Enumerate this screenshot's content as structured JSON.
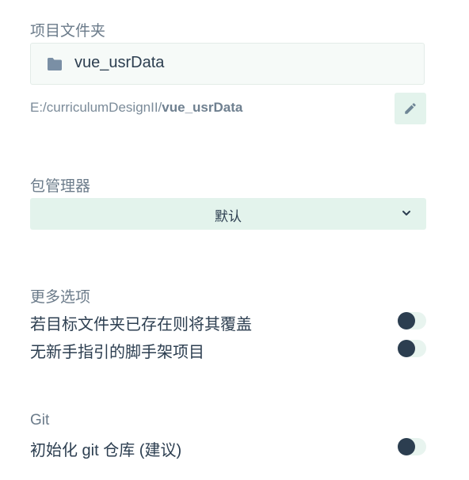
{
  "project_folder": {
    "section_label": "项目文件夹",
    "folder_name": "vue_usrData",
    "path_prefix": "E:/curriculumDesignII/",
    "path_bold": "vue_usrData",
    "icon": "folder-icon",
    "edit_icon": "pencil-icon"
  },
  "package_manager": {
    "section_label": "包管理器",
    "selected_value": "默认",
    "icon": "chevron-down-icon"
  },
  "more_options": {
    "section_label": "更多选项",
    "options": [
      {
        "label": "若目标文件夹已存在则将其覆盖",
        "enabled": false
      },
      {
        "label": "无新手指引的脚手架项目",
        "enabled": false
      }
    ]
  },
  "git": {
    "section_label": "Git",
    "options": [
      {
        "label": "初始化 git 仓库 (建议)",
        "enabled": false
      }
    ]
  },
  "colors": {
    "text_primary": "#2c3e50",
    "text_muted": "#6b7b8a",
    "accent_bg": "#e3f3ec",
    "toggle_knob": "#2c3e50"
  }
}
